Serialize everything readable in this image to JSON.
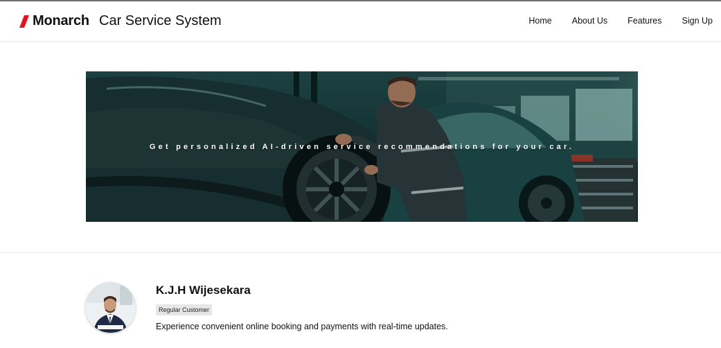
{
  "brand": {
    "name": "Monarch",
    "accent_color": "#e4141e",
    "logo_icon": "slash-mark-icon"
  },
  "header": {
    "app_title": "Car Service System"
  },
  "nav": {
    "items": [
      {
        "label": "Home"
      },
      {
        "label": "About Us"
      },
      {
        "label": "Features"
      },
      {
        "label": "Sign Up"
      }
    ]
  },
  "hero": {
    "tagline": "Get personalized AI-driven service recommendations for your car.",
    "image": "mechanic-servicing-sports-car"
  },
  "profile": {
    "name": "K.J.H Wijesekara",
    "badge": "Regular Customer",
    "description": "Experience convenient online booking and payments with real-time updates.",
    "avatar": "businessman-portrait"
  }
}
